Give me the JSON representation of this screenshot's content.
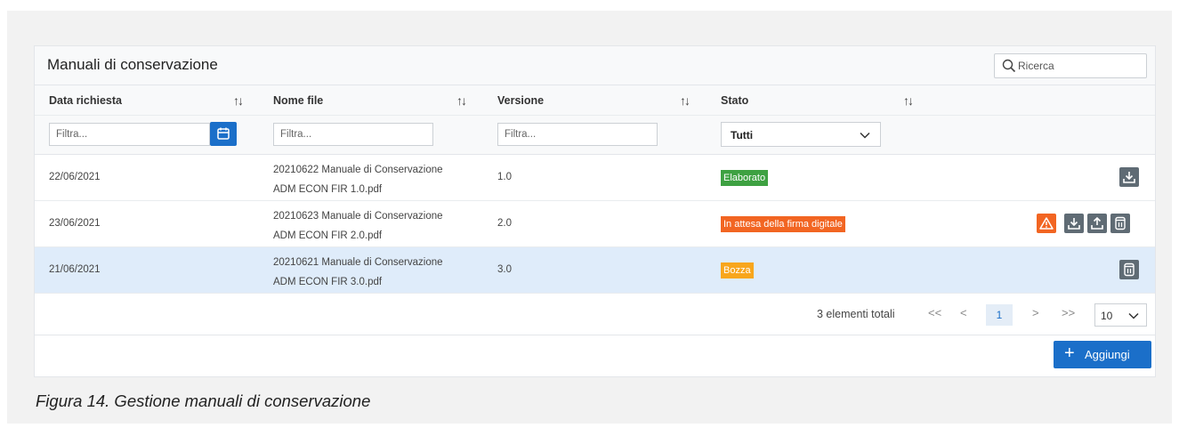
{
  "panel": {
    "title": "Manuali di conservazione",
    "search_placeholder": "Ricerca"
  },
  "columns": [
    {
      "label": "Data richiesta",
      "sort_icon": "sort-arrows-icon"
    },
    {
      "label": "Nome file",
      "sort_icon": "sort-arrows-icon"
    },
    {
      "label": "Versione",
      "sort_icon": "sort-arrows-icon"
    },
    {
      "label": "Stato",
      "sort_icon": "sort-arrows-icon"
    }
  ],
  "filters": {
    "date_placeholder": "Filtra...",
    "file_placeholder": "Filtra...",
    "version_placeholder": "Filtra...",
    "state_value": "Tutti"
  },
  "rows": [
    {
      "date": "22/06/2021",
      "file_line1": "20210622 Manuale di Conservazione",
      "file_line2": "ADM ECON FIR 1.0.pdf",
      "version": "1.0",
      "state": "Elaborato",
      "state_color": "#3ea142",
      "actions": [
        "download-icon"
      ]
    },
    {
      "date": "23/06/2021",
      "file_line1": "20210623 Manuale di Conservazione",
      "file_line2": "ADM ECON FIR 2.0.pdf",
      "version": "2.0",
      "state": "In attesa della firma digitale",
      "state_color": "#f26522",
      "actions": [
        "warning-icon",
        "download-icon",
        "upload-icon",
        "trash-icon"
      ]
    },
    {
      "date": "21/06/2021",
      "file_line1": "20210621 Manuale di Conservazione",
      "file_line2": "ADM ECON FIR 3.0.pdf",
      "version": "3.0",
      "state": "Bozza",
      "state_color": "#f8a61c",
      "actions": [
        "trash-icon"
      ],
      "selected": true
    }
  ],
  "pagination": {
    "total_text": "3 elementi totali",
    "first": "<<",
    "prev": "<",
    "current_page": "1",
    "next": ">",
    "last": ">>",
    "per_page": "10"
  },
  "add_button": {
    "label": "Aggiungi"
  },
  "caption": "Figura 14. Gestione manuali di conservazione",
  "colors": {
    "primary": "#1b6fc9",
    "action_gray": "#5f6b74",
    "selected_row": "#dfecfa"
  }
}
